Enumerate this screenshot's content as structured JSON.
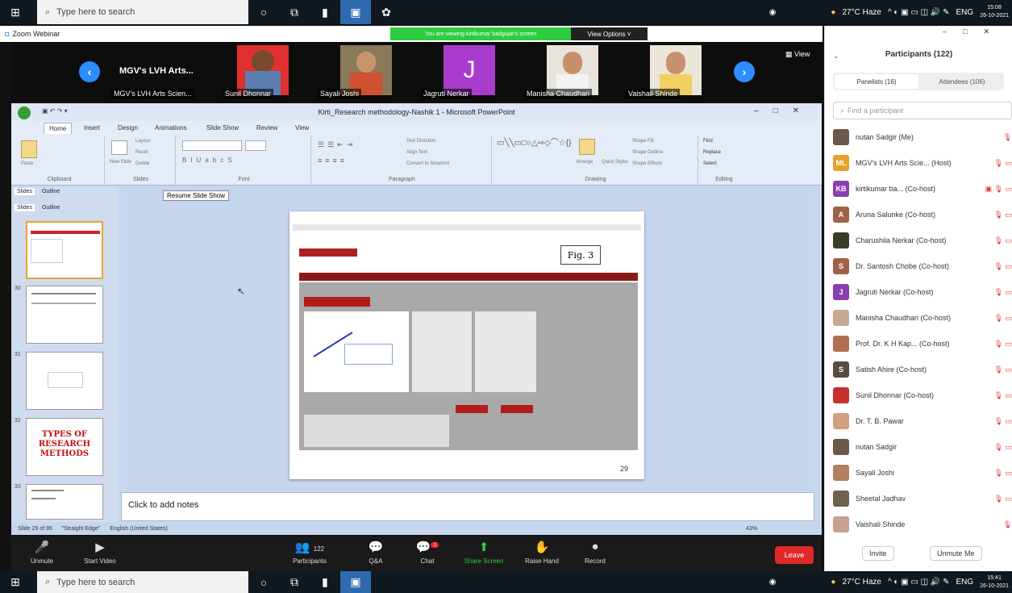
{
  "taskbar_top": {
    "search_placeholder": "Type here to search",
    "weather": "27°C Haze",
    "lang": "ENG",
    "time": "15:08",
    "date": "26-10-2021"
  },
  "taskbar_bottom": {
    "search_placeholder": "Type here to search",
    "weather": "27°C Haze",
    "lang": "ENG",
    "time": "15:41",
    "date": "26-10-2021"
  },
  "zoom": {
    "window_title": "Zoom Webinar",
    "banner": "You are viewing kirtikumar badgujar's screen",
    "view_options": "View Options ˅",
    "view_label": "View",
    "gallery": [
      {
        "title": "MGV's LVH Arts...",
        "name": "MGV's LVH Arts Scien..."
      },
      {
        "name": "Sunil Dhonnar"
      },
      {
        "name": "Sayali Joshi"
      },
      {
        "initial": "J",
        "name": "Jagruti Nerkar"
      },
      {
        "name": "Manisha Chaudhari"
      },
      {
        "name": "Vaishali Shinde"
      }
    ],
    "bottom": {
      "unmute": "Unmute",
      "start_video": "Start Video",
      "participants": "Participants",
      "participants_count": "122",
      "qa": "Q&A",
      "chat": "Chat",
      "chat_badge": "1",
      "share_screen": "Share Screen",
      "raise_hand": "Raise Hand",
      "record": "Record",
      "leave": "Leave"
    }
  },
  "ppt": {
    "title": "Kirti_Research methodology-Nashik 1 - Microsoft PowerPoint",
    "tabs": [
      "Home",
      "Insert",
      "Design",
      "Animations",
      "Slide Show",
      "Review",
      "View"
    ],
    "groups": [
      "Clipboard",
      "Slides",
      "Font",
      "Paragraph",
      "Drawing",
      "Editing"
    ],
    "buttons": {
      "paste": "Paste",
      "new_slide": "New Slide",
      "layout": "Layout",
      "reset": "Reset",
      "delete": "Delete",
      "arrange": "Arrange",
      "quick_styles": "Quick Styles",
      "find": "Find",
      "replace": "Replace",
      "select": "Select",
      "text_direction": "Text Direction",
      "align_text": "Align Text",
      "convert_smartart": "Convert to SmartArt",
      "shape_fill": "Shape Fill",
      "shape_outline": "Shape Outline",
      "shape_effects": "Shape Effects"
    },
    "panel_tabs": [
      "Slides",
      "Outline"
    ],
    "resume_slideshow": "Resume Slide Show",
    "slide_numbers": [
      "30",
      "31",
      "32",
      "33"
    ],
    "types_slide_text": "TYPES OF RESEARCH METHODS",
    "slide_fig_label": "Fig. 3",
    "slide_page_number": "29",
    "notes_placeholder": "Click to add notes",
    "status": {
      "slide": "Slide 29 of 95",
      "theme": "\"Straight Edge\"",
      "language": "English (United States)",
      "zoom": "43%"
    }
  },
  "participants_panel": {
    "title": "Participants (122)",
    "tab_panelists": "Panelists (16)",
    "tab_attendees": "Attendees (106)",
    "search_placeholder": "Find a participant",
    "invite": "Invite",
    "unmute_me": "Unmute Me",
    "rows": [
      {
        "name": "nutan Sadgir (Me)",
        "color": "#6b5a48",
        "initial": "",
        "icons": "🎙"
      },
      {
        "name": "MGV's LVH Arts Scie...  (Host)",
        "color": "#e8a030",
        "initial": "ML",
        "icons": "🎙 ▭"
      },
      {
        "name": "kirtikumar ba...  (Co-host)",
        "color": "#8a3fb0",
        "initial": "KB",
        "icons": "▣ 🎙 ▭"
      },
      {
        "name": "Aruna Salunke (Co-host)",
        "color": "#a0614a",
        "initial": "A",
        "icons": "🎙 ▭"
      },
      {
        "name": "Charushila Nerkar (Co-host)",
        "color": "#3b3b2a",
        "initial": "",
        "icons": "🎙 ▭"
      },
      {
        "name": "Dr. Santosh Chobe (Co-host)",
        "color": "#a0614a",
        "initial": "S",
        "icons": "🎙 ▭"
      },
      {
        "name": "Jagruti Nerkar (Co-host)",
        "color": "#8a3fb0",
        "initial": "J",
        "icons": "🎙 ▭"
      },
      {
        "name": "Manisha Chaudhari (Co-host)",
        "color": "#c9a890",
        "initial": "",
        "icons": "🎙 ▭"
      },
      {
        "name": "Prof. Dr. K H Kap...  (Co-host)",
        "color": "#b07050",
        "initial": "",
        "icons": "🎙 ▭"
      },
      {
        "name": "Satish Ahire (Co-host)",
        "color": "#5a4a40",
        "initial": "S",
        "icons": "🎙 ▭"
      },
      {
        "name": "Sunil Dhonnar (Co-host)",
        "color": "#c83030",
        "initial": "",
        "icons": "🎙 ▭"
      },
      {
        "name": "Dr. T. B. Pawar",
        "color": "#d0a080",
        "initial": "",
        "icons": "🎙 ▭"
      },
      {
        "name": "nutan Sadgir",
        "color": "#6b5a48",
        "initial": "",
        "icons": "🎙 ▭"
      },
      {
        "name": "Sayali Joshi",
        "color": "#b08060",
        "initial": "",
        "icons": "🎙 ▭"
      },
      {
        "name": "Sheetal Jadhav",
        "color": "#706050",
        "initial": "",
        "icons": "🎙 ▭"
      },
      {
        "name": "Vaishali Shinde",
        "color": "#c8a090",
        "initial": "",
        "icons": "🎙"
      }
    ]
  }
}
